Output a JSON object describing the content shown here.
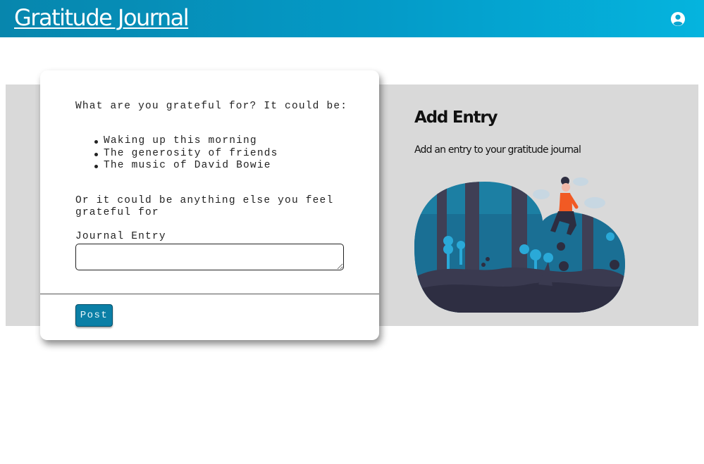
{
  "header": {
    "brand": "Gratitude Journal",
    "account_icon": "account-circle-icon",
    "colors": {
      "bar_start": "#0786ad",
      "bar_end": "#05b4de"
    }
  },
  "form_card": {
    "prompt": "What are you grateful for? It could be:",
    "suggestions": [
      "Waking up this morning",
      "The generosity of friends",
      "The music of David Bowie"
    ],
    "else_text": "Or it could be anything else you feel grateful for",
    "entry_label": "Journal Entry",
    "entry_value": "",
    "post_label": "Post",
    "colors": {
      "post_button": "#0b7fa6"
    }
  },
  "side_panel": {
    "title": "Add Entry",
    "subtitle": "Add an entry to your gratitude journal",
    "illustration": "woman-sitting-in-forest-illustration",
    "colors": {
      "band": "#d9d9d9",
      "accent": "#1c7fa3"
    }
  }
}
